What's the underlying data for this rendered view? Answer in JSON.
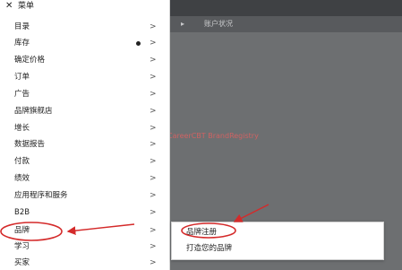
{
  "menu": {
    "title": "菜单",
    "close_glyph": "✕",
    "chevron_glyph": ">",
    "items": [
      {
        "label": "目录"
      },
      {
        "label": "库存",
        "has_dot": true
      },
      {
        "label": "确定价格"
      },
      {
        "label": "订单"
      },
      {
        "label": "广告"
      },
      {
        "label": "品牌旗舰店"
      },
      {
        "label": "增长"
      },
      {
        "label": "数据报告"
      },
      {
        "label": "付款"
      },
      {
        "label": "绩效"
      },
      {
        "label": "应用程序和服务"
      },
      {
        "label": "B2B"
      },
      {
        "label": "品牌",
        "highlighted": true
      },
      {
        "label": "学习"
      },
      {
        "label": "买家"
      }
    ]
  },
  "app": {
    "subbar": [
      "▸",
      "账户状况"
    ]
  },
  "watermark": "微信：CareerCBT BrandRegistry",
  "submenu": {
    "items": [
      "品牌注册",
      "打造您的品牌"
    ]
  },
  "colors": {
    "overlay": "#6d6f71",
    "annotation_red": "#d42a2a"
  }
}
